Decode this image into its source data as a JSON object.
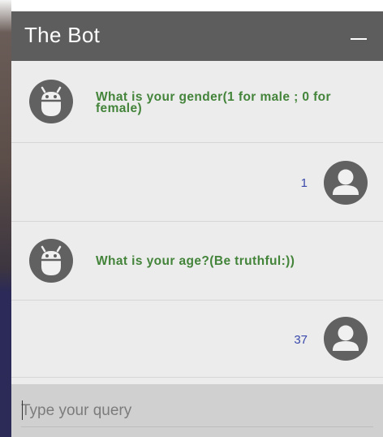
{
  "header": {
    "title": "The Bot"
  },
  "messages": [
    {
      "sender": "bot",
      "icon": "android-bot-icon",
      "text": "What is your gender(1 for male ; 0 for female)"
    },
    {
      "sender": "user",
      "icon": "user-avatar-icon",
      "text": "1"
    },
    {
      "sender": "bot",
      "icon": "android-bot-icon",
      "text": "What is your age?(Be truthful:))"
    },
    {
      "sender": "user",
      "icon": "user-avatar-icon",
      "text": "37"
    }
  ],
  "input": {
    "placeholder": "Type your query",
    "value": ""
  },
  "colors": {
    "header_bg": "#5d5d5d",
    "bot_text": "#43843a",
    "user_text": "#3949ab",
    "chat_bg": "#ececec",
    "input_bg": "#d0d0d0"
  }
}
